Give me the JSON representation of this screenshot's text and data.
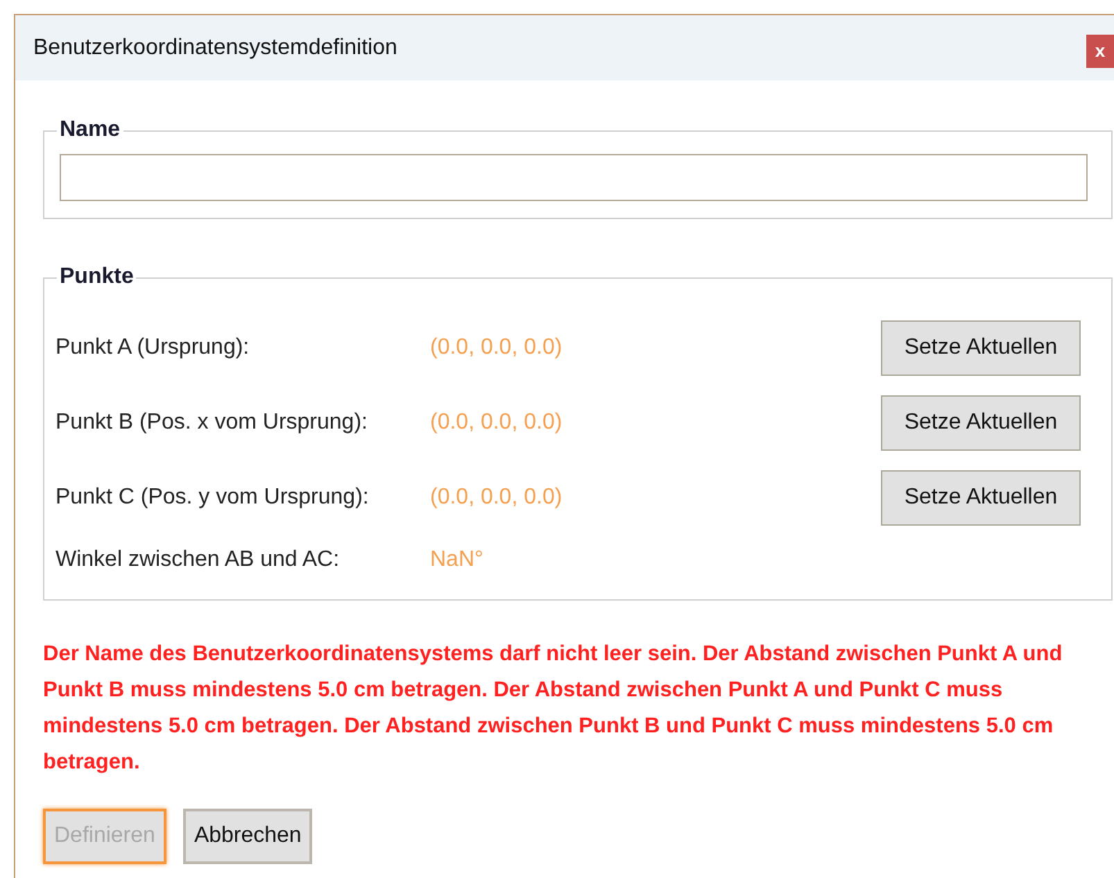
{
  "window": {
    "title": "Benutzerkoordinatensystemdefinition",
    "close": "x"
  },
  "name_group": {
    "label": "Name"
  },
  "points_group": {
    "label": "Punkte",
    "rows": [
      {
        "kind": "point",
        "label": "Punkt A (Ursprung):",
        "value": "(0.0, 0.0, 0.0)",
        "button": "Setze Aktuellen"
      },
      {
        "kind": "point",
        "label": "Punkt B (Pos. x vom Ursprung):",
        "value": "(0.0, 0.0, 0.0)",
        "button": "Setze Aktuellen"
      },
      {
        "kind": "point",
        "label": "Punkt C (Pos. y vom Ursprung):",
        "value": "(0.0, 0.0, 0.0)",
        "button": "Setze Aktuellen"
      },
      {
        "kind": "angle",
        "label": "Winkel zwischen AB und AC:",
        "value": "NaN°"
      }
    ]
  },
  "error": "Der Name des Benutzerkoordinatensystems darf nicht leer sein. Der Abstand zwischen Punkt A und Punkt B muss mindestens 5.0 cm betragen. Der Abstand zwischen Punkt A und Punkt C muss mindestens 5.0 cm betragen. Der Abstand zwischen Punkt B und Punkt C muss mindestens 5.0 cm betragen.",
  "buttons": [
    {
      "label": "Definieren",
      "disabled": true,
      "focused": true
    },
    {
      "label": "Abbrechen",
      "disabled": false,
      "focused": false
    }
  ]
}
